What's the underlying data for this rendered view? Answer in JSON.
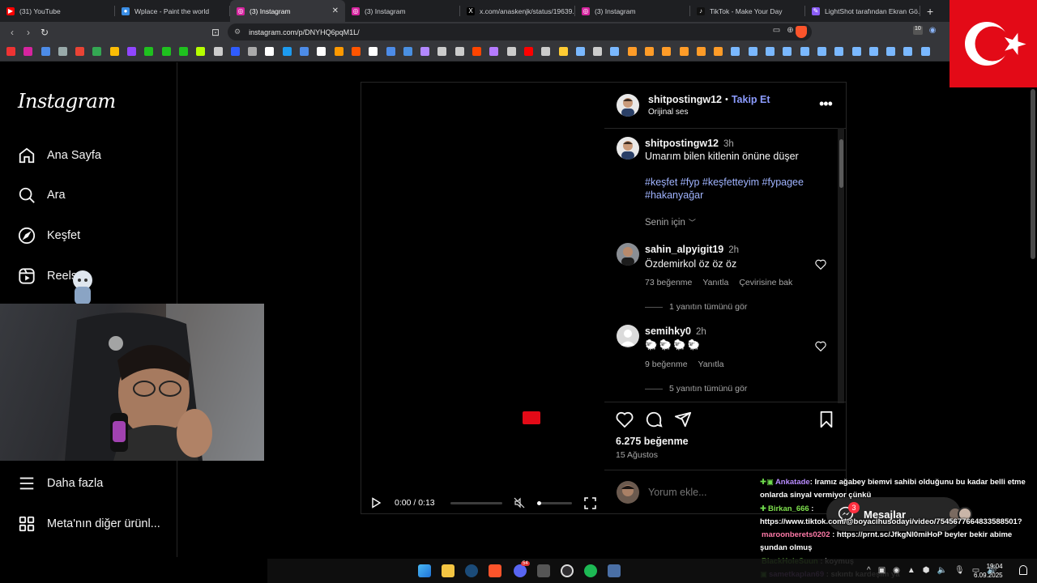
{
  "browser": {
    "tabs": [
      {
        "label": "(31) YouTube",
        "fav_color": "#ff0000",
        "fav_glyph": "▶",
        "width": 142
      },
      {
        "label": "Wplace - Paint the world",
        "fav_color": "#3a8ee6",
        "fav_glyph": "●",
        "width": 142
      },
      {
        "label": "(3) Instagram",
        "fav_color": "#d6249f",
        "fav_glyph": "◎",
        "width": 142,
        "active": true
      },
      {
        "label": "(3) Instagram",
        "fav_color": "#d6249f",
        "fav_glyph": "◎",
        "width": 142
      },
      {
        "label": "x.com/anaskenjk/status/19639...",
        "fav_color": "#000000",
        "fav_glyph": "X",
        "width": 142
      },
      {
        "label": "(3) Instagram",
        "fav_color": "#d6249f",
        "fav_glyph": "◎",
        "width": 142
      },
      {
        "label": "TikTok - Make Your Day",
        "fav_color": "#111111",
        "fav_glyph": "♪",
        "width": 142
      },
      {
        "label": "LightShot tarafından Ekran Gö...",
        "fav_color": "#8a5cf6",
        "fav_glyph": "✎",
        "width": 142
      }
    ],
    "new_tab_glyph": "+",
    "url": "instagram.com/p/DNYHQ6pqM1L/",
    "ext_badge": "10",
    "bookmark_colors": [
      "#e33",
      "#d6249f",
      "#4d8ce8",
      "#9aa",
      "#ea4335",
      "#34a853",
      "#fbbc05",
      "#9146ff",
      "#1fc11f",
      "#1fc11f",
      "#1fc11f",
      "#b6ff00",
      "#ccc",
      "#2f5cff",
      "#aaa",
      "#fff",
      "#1d9bf0",
      "#4d8ce8",
      "#fff",
      "#ff9900",
      "#ff5500",
      "#fff",
      "#4d8ce8",
      "#4a90e2",
      "#b388ff",
      "#ccc",
      "#ccc",
      "#ff4500",
      "#b57bff",
      "#ccc",
      "#ff0000",
      "#ccc",
      "#ffcc33",
      "#7ab8ff",
      "#ccc",
      "#7ab8ff",
      "#ff9c28",
      "#ff9c28",
      "#ff9c28",
      "#ff9c28",
      "#ff9c28",
      "#ff9c28",
      "#7ab8ff",
      "#7ab8ff",
      "#7ab8ff",
      "#7ab8ff",
      "#7ab8ff",
      "#7ab8ff",
      "#7ab8ff",
      "#7ab8ff",
      "#7ab8ff",
      "#7ab8ff",
      "#7ab8ff",
      "#7ab8ff"
    ]
  },
  "sidebar": {
    "logo": "Instagram",
    "items": [
      {
        "label": "Ana Sayfa",
        "icon": "home-icon"
      },
      {
        "label": "Ara",
        "icon": "search-icon"
      },
      {
        "label": "Keşfet",
        "icon": "compass-icon"
      },
      {
        "label": "Reels",
        "icon": "reels-icon"
      }
    ],
    "bottom_items": [
      {
        "label": "Daha fazla",
        "icon": "menu-icon"
      },
      {
        "label": "Meta'nın diğer ürünl...",
        "icon": "grid-icon"
      }
    ]
  },
  "post": {
    "author": "shitpostingw12",
    "follow_label": "Takip Et",
    "separator": "•",
    "audio": "Orijinal ses",
    "caption_time": "3h",
    "caption": "Umarım bilen kitlenin önüne düşer",
    "hashtags_line1": "#keşfet #fyp #keşfetteyim #fypagee",
    "hashtags_line2": "#hakanyağar",
    "for_you": "Senin için",
    "comments": [
      {
        "user": "sahin_alpyigit19",
        "time": "2h",
        "text": "Özdemirkol öz öz öz",
        "likes": "73 beğenme",
        "reply": "Yanıtla",
        "translate": "Çevirisine bak",
        "view_replies": "1 yanıtın tümünü gör"
      },
      {
        "user": "semihky0",
        "time": "2h",
        "text": "🐑🐑🐑🐑",
        "likes": "9 beğenme",
        "reply": "Yanıtla",
        "translate": "",
        "view_replies": "5 yanıtın tümünü gör"
      }
    ],
    "likes": "6.275 beğenme",
    "date": "15 Ağustos",
    "comment_placeholder": "Yorum ekle...",
    "video_time": "0:00 / 0:13"
  },
  "messages": {
    "label": "Mesajlar",
    "badge": "3"
  },
  "chat": [
    {
      "user": "Ankatade",
      "user_color": "#b98cff",
      "text": ": Iramız ağabey biemvi sahibi olduğunu bu kadar belli etme",
      "prefix": "✚▣"
    },
    {
      "user": "",
      "user_color": "#fff",
      "text": "onlarda sinyal vermiyor çünkü",
      "prefix": ""
    },
    {
      "user": "Birkan_666",
      "user_color": "#7ee04d",
      "text": " :",
      "prefix": "✚"
    },
    {
      "user": "",
      "user_color": "#fff",
      "text": "https://www.tiktok.com/@boyacihusodayi/video/7545677664833588501?",
      "prefix": ""
    },
    {
      "user": "maroonberets0202",
      "user_color": "#ff7aa8",
      "text": " : https://prnt.sc/JfkgNl0miHoP beyler bekir abime",
      "prefix": ""
    },
    {
      "user": "",
      "user_color": "#fff",
      "text": "şundan olmuş",
      "prefix": ""
    },
    {
      "user": "BlackHoleSuun",
      "user_color": "#7ee04d",
      "text": " : koymuş",
      "prefix": ""
    },
    {
      "user": "sametkaplan69",
      "user_color": "#d18cff",
      "text": " : sıkıntı kardeşim ya",
      "prefix": "▣"
    }
  ],
  "taskbar": {
    "time": "19:04",
    "date": "6.09.2025",
    "discord_badge": "54"
  }
}
